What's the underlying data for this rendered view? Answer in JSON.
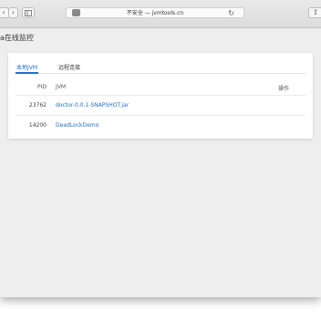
{
  "browser": {
    "back": "‹",
    "forward": "›",
    "url": "不安全 — jvmtools.cn",
    "reload": "↻",
    "share": "⇧",
    "icons": [
      "sidebar-icon",
      "shield-icon",
      "reload-icon",
      "share-icon"
    ]
  },
  "app": {
    "title": "a在线监控"
  },
  "tabs": [
    {
      "label": "本地JVM",
      "active": true
    },
    {
      "label": "远程连接",
      "active": false
    }
  ],
  "table": {
    "columns": [
      "PID",
      "JVM",
      "操作"
    ],
    "rows": [
      {
        "pid": "23762",
        "jvm": "doctor-0.0.1-SNAPSHOT.jar"
      },
      {
        "pid": "14200",
        "jvm": "DeadLockDemo"
      }
    ]
  },
  "colors": {
    "accent": "#1f6fcf",
    "background": "#eeeeee"
  }
}
